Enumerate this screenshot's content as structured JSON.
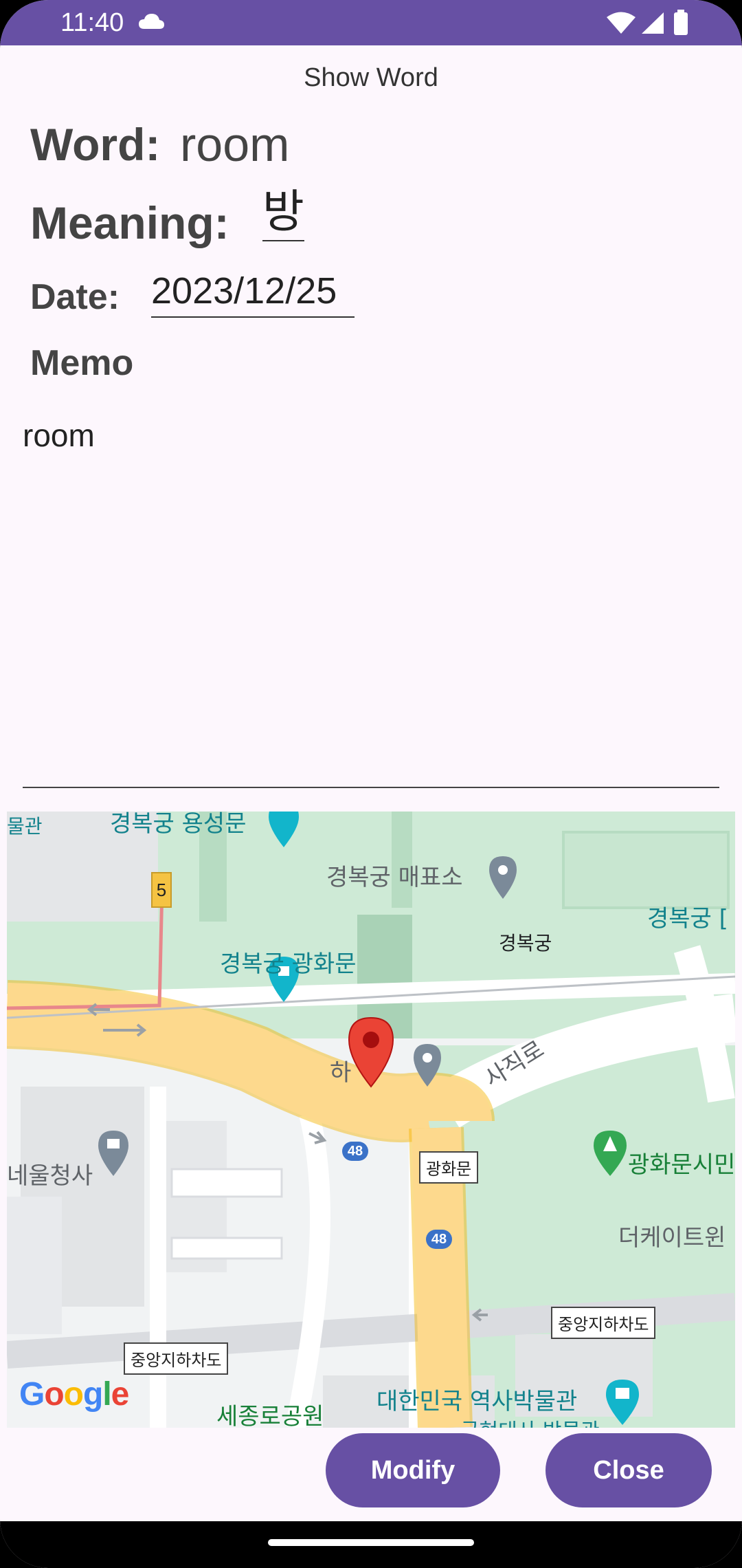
{
  "status_bar": {
    "time": "11:40"
  },
  "app": {
    "title": "Show Word"
  },
  "fields": {
    "word_label": "Word:",
    "word_value": "room",
    "meaning_label": "Meaning:",
    "meaning_value": "방",
    "date_label": "Date:",
    "date_value": "2023/12/25",
    "memo_label": "Memo",
    "memo_value": "room"
  },
  "map": {
    "labels": {
      "top_left_partial": "물관",
      "yongseongmun": "경복궁 용성문",
      "ticket_office": "경복궁 매표소",
      "gyeongbokgung_right": "경복궁 [",
      "gyeongbokgung": "경복궁",
      "gwanghwamun_gate": "경복궁 광화문",
      "marker_label": "하",
      "sajik_ro": "사직로",
      "gwanghwamun_box": "광화문",
      "seoul_hall": "네울청사",
      "gwanghwamun_plaza": "광화문시민",
      "the_kayton": "더케이트윈",
      "underground_stop_right": "중앙지하차도",
      "underground_stop_left": "중앙지하차도",
      "sejong_park": "세종로공원",
      "history_museum": "대한민국 역사박물관",
      "history_museum_sub": "국현대사 박물관",
      "route_5": "5",
      "road_48_a": "48",
      "road_48_b": "48"
    },
    "attribution": "Google"
  },
  "buttons": {
    "modify": "Modify",
    "close": "Close"
  },
  "colors": {
    "accent": "#6750A4",
    "background": "#FDF7FD",
    "map_green": "#CEEAD6",
    "road_yellow": "#FDD98D",
    "marker_red": "#EA4335"
  }
}
